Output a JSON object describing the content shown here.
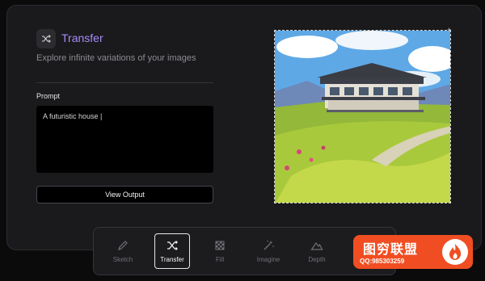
{
  "header": {
    "title": "Transfer",
    "subtitle": "Explore infinite variations of your images",
    "icon": "shuffle-icon"
  },
  "prompt": {
    "label": "Prompt",
    "value": "A futuristic house |"
  },
  "actions": {
    "view_output": "View Output"
  },
  "toolbar": {
    "tools": [
      {
        "label": "Sketch",
        "icon": "pencil-icon",
        "active": false
      },
      {
        "label": "Transfer",
        "icon": "shuffle-icon",
        "active": true
      },
      {
        "label": "Fill",
        "icon": "checker-icon",
        "active": false
      },
      {
        "label": "Imagine",
        "icon": "magic-wand-icon",
        "active": false
      },
      {
        "label": "Depth",
        "icon": "mountain-icon",
        "active": false
      }
    ]
  },
  "watermark": {
    "title": "图穷联盟",
    "contact": "QQ:985303259"
  },
  "colors": {
    "accent": "#a78bfa",
    "panel": "#1a1a1c",
    "badge": "#f04e22"
  }
}
